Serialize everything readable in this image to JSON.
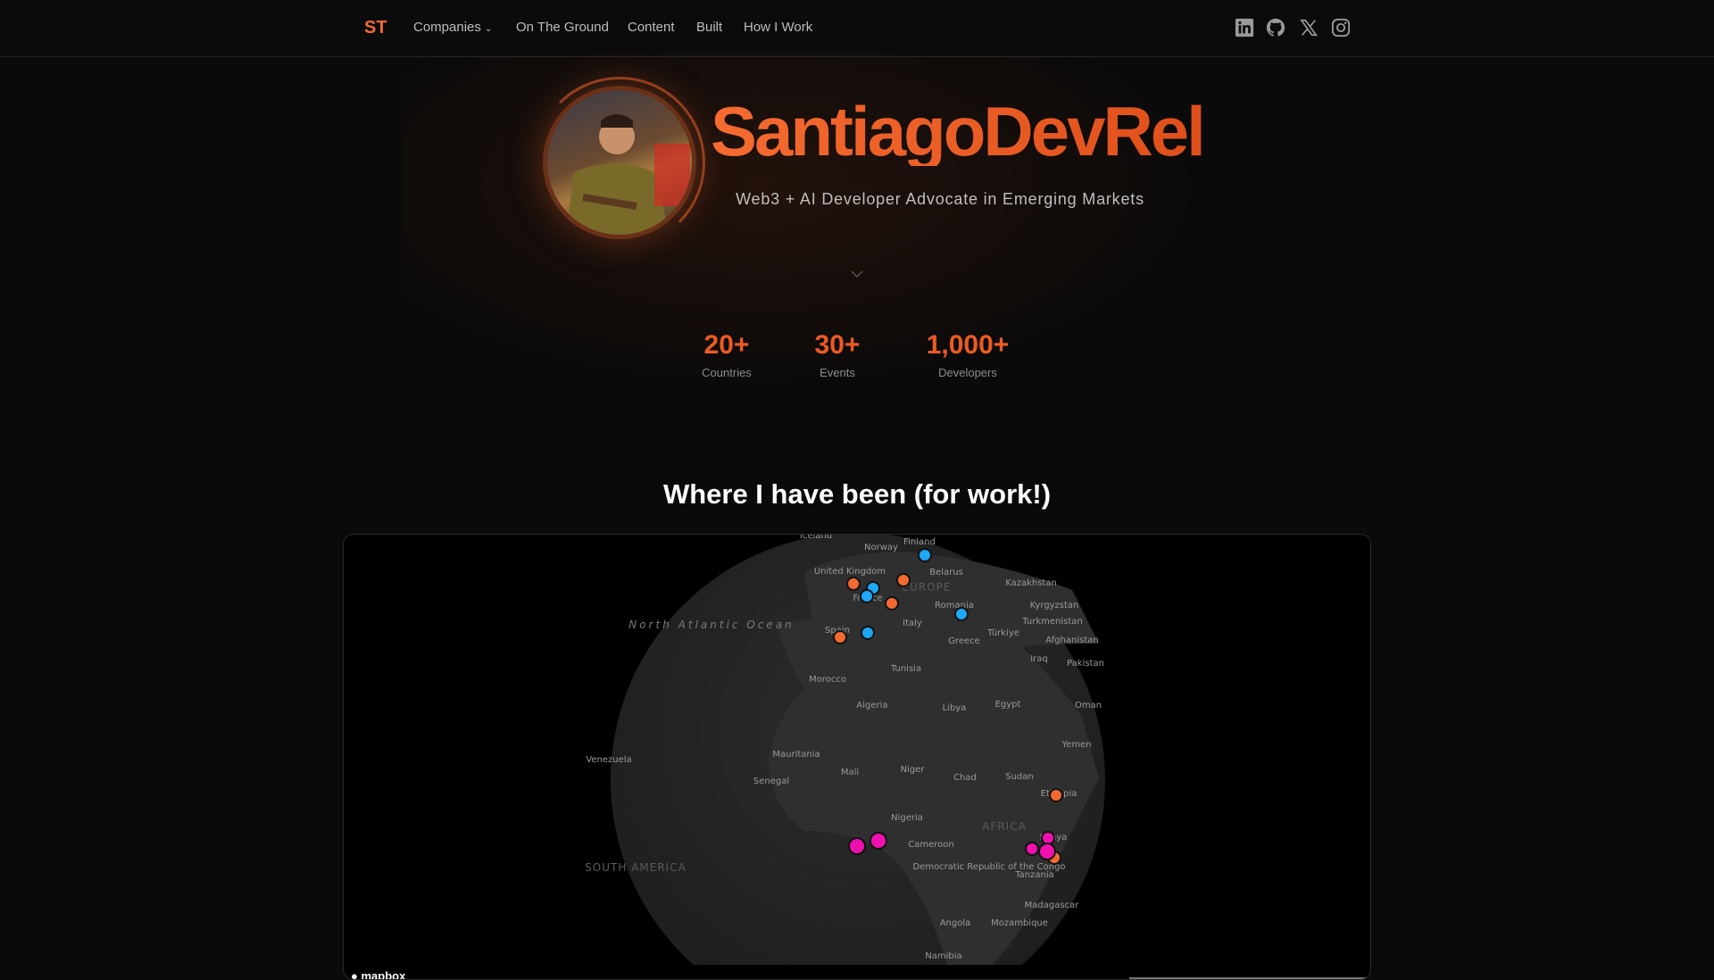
{
  "nav": {
    "logo": "ST",
    "items": [
      {
        "label": "Companies",
        "has_dropdown": true
      },
      {
        "label": "On The Ground"
      },
      {
        "label": "Content"
      },
      {
        "label": "Built"
      },
      {
        "label": "How I Work"
      }
    ],
    "social": [
      "linkedin-icon",
      "github-icon",
      "x-icon",
      "instagram-icon"
    ]
  },
  "hero": {
    "title": "SantiagoDevRel",
    "subtitle": "Web3 + AI Developer Advocate in Emerging Markets"
  },
  "stats": [
    {
      "value": "20+",
      "label": "Countries"
    },
    {
      "value": "30+",
      "label": "Events"
    },
    {
      "value": "1,000+",
      "label": "Developers"
    }
  ],
  "map": {
    "heading": "Where I have been (for work!)",
    "attribution": "mapbox",
    "labels": [
      "Iceland",
      "Norway",
      "Finland",
      "United Kingdom",
      "Belarus",
      "EUROPE",
      "Kazakhstan",
      "France",
      "Romania",
      "Kyrgyzstan",
      "Turkmenistan",
      "Italy",
      "Türkiye",
      "Spain",
      "Greece",
      "Afghanistan",
      "Iraq",
      "Pakistan",
      "Tunisia",
      "Morocco",
      "Algeria",
      "Libya",
      "Egypt",
      "Oman",
      "Yemen",
      "Venezuela",
      "Mauritania",
      "Mali",
      "Niger",
      "Chad",
      "Sudan",
      "Senegal",
      "Ethiopia",
      "Nigeria",
      "AFRICA",
      "Kenya",
      "Cameroon",
      "SOUTH AMERICA",
      "Democratic Republic of the Congo",
      "Tanzania",
      "Madagascar",
      "Angola",
      "Mozambique",
      "Namibia",
      "North Atlantic Ocean"
    ],
    "colors": {
      "orange": "#f26a2e",
      "blue": "#1ea7f5",
      "pink": "#f010b0"
    }
  }
}
